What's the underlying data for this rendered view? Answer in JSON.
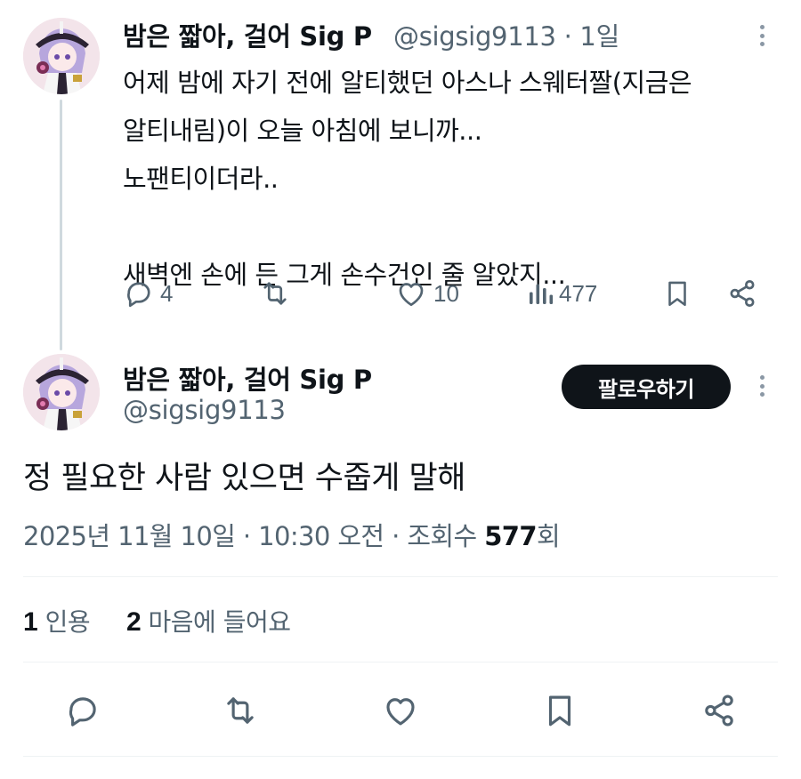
{
  "first_tweet": {
    "author_name": "밤은 짧아, 걸어 Sig P",
    "handle": "@sigsig9113",
    "separator": "·",
    "time": "1일",
    "lines": [
      "어제 밤에 자기 전에 알티했던 아스나 스웨터짤(지금은",
      "알티내림)이 오늘 아침에 보니까...",
      "노팬티이더라..",
      "",
      "새벽엔 손에 든 그게 손수건인 줄 알았지..."
    ],
    "actions": {
      "replies": "4",
      "retweets": "",
      "likes": "10",
      "views": "477"
    }
  },
  "main_tweet": {
    "author_name": "밤은 짧아, 걸어 Sig P",
    "handle": "@sigsig9113",
    "follow_label": "팔로우하기",
    "text": "정 필요한 사람 있으면 수줍게 말해",
    "date": "2025년 11월 10일 · 10:30 오전 · 조회수 ",
    "views_count": "577",
    "views_suffix": "회",
    "quotes_count": "1",
    "quotes_label": "인용",
    "likes_count": "2",
    "likes_label": "마음에 들어요"
  },
  "colors": {
    "text": "#0f1419",
    "secondary": "#536471",
    "divider": "#eff3f4",
    "thread_line": "#cfd9de",
    "follow_button_bg": "#0f1419"
  },
  "icons": [
    "reply-icon",
    "retweet-icon",
    "like-icon",
    "views-icon",
    "bookmark-icon",
    "share-icon",
    "more-icon"
  ]
}
